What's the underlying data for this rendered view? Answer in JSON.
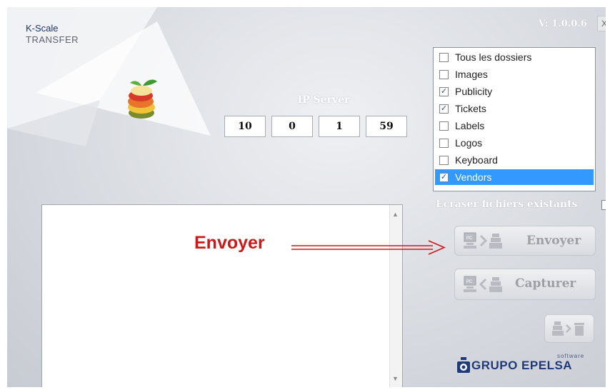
{
  "app": {
    "brand_line1": "K-Scale",
    "brand_line2": "TRANSFER",
    "version": "V: 1.0.0.6",
    "close_label": "X"
  },
  "ip_server": {
    "label": "IP Server",
    "octets": [
      "10",
      "0",
      "1",
      "59"
    ]
  },
  "folders": [
    {
      "label": "Tous les dossiers",
      "checked": false,
      "selected": false
    },
    {
      "label": "Images",
      "checked": false,
      "selected": false
    },
    {
      "label": "Publicity",
      "checked": true,
      "selected": false
    },
    {
      "label": "Tickets",
      "checked": true,
      "selected": false
    },
    {
      "label": "Labels",
      "checked": false,
      "selected": false
    },
    {
      "label": "Logos",
      "checked": false,
      "selected": false
    },
    {
      "label": "Keyboard",
      "checked": false,
      "selected": false
    },
    {
      "label": "Vendors",
      "checked": true,
      "selected": true
    }
  ],
  "options": {
    "overwrite_label": "Ecraser fichiers existants",
    "overwrite_checked": false
  },
  "annotation": {
    "text": "Envoyer",
    "color": "#cc1a1a"
  },
  "buttons": {
    "send_label": "Envoyer",
    "capture_label": "Capturer"
  },
  "logo": {
    "small": "software",
    "name": "GRUPO EPELSA"
  },
  "colors": {
    "selection": "#3399ff",
    "brand": "#1f3a7a"
  }
}
